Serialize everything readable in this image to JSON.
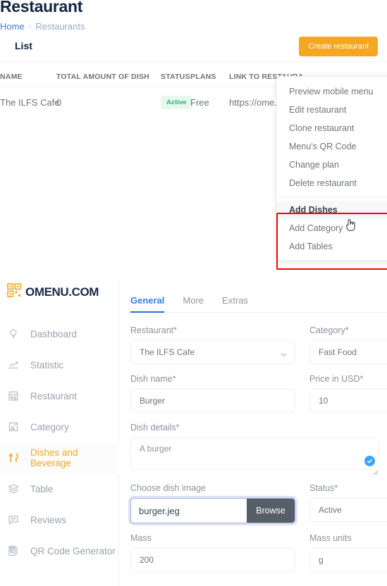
{
  "top": {
    "page_title": "Restaurant",
    "breadcrumb": {
      "home": "Home",
      "separator": "›",
      "current": "Restaurants"
    },
    "card": {
      "title": "List",
      "create_button": "Create restaurant"
    },
    "table": {
      "headers": [
        "NAME",
        "TOTAL AMOUNT OF DISH",
        "STATUS",
        "PLANS",
        "LINK TO RESTAURA"
      ],
      "rows": [
        {
          "name": "The ILFS Cafe",
          "total_amount_of_dish": "0",
          "status": "Active",
          "plans": "Free",
          "link": "https://ome.nu/"
        }
      ]
    },
    "dropdown": {
      "group_1": [
        "Preview mobile menu",
        "Edit restaurant",
        "Clone restaurant",
        "Menu's QR Code",
        "Change plan",
        "Delete restaurant"
      ],
      "group_2": [
        "Add Dishes",
        "Add Category",
        "Add Tables"
      ],
      "hovered_item": "Add Dishes",
      "highlight_color": "#ff0000"
    }
  },
  "bottom": {
    "brand": {
      "name": "OMENU.COM",
      "icon": "qr-code-icon"
    },
    "sidebar": {
      "items": [
        {
          "label": "Dashboard",
          "icon": "lightbulb-icon",
          "active": false
        },
        {
          "label": "Statistic",
          "icon": "trend-up-icon",
          "active": false
        },
        {
          "label": "Restaurant",
          "icon": "store-icon",
          "active": false
        },
        {
          "label": "Category",
          "icon": "signpost-icon",
          "active": false
        },
        {
          "label": "Dishes and Beverage",
          "icon": "cutlery-icon",
          "active": true
        },
        {
          "label": "Table",
          "icon": "layers-icon",
          "active": false
        },
        {
          "label": "Reviews",
          "icon": "comment-icon",
          "active": false
        },
        {
          "label": "QR Code Generator",
          "icon": "qr-generator-icon",
          "active": false
        }
      ],
      "active_color": "#f5a623"
    },
    "form": {
      "tabs": [
        {
          "label": "General",
          "active": true
        },
        {
          "label": "More",
          "active": false
        },
        {
          "label": "Extras",
          "active": false
        }
      ],
      "fields": {
        "restaurant": {
          "label": "Restaurant*",
          "value": "The ILFS Cafe"
        },
        "category": {
          "label": "Category*",
          "value": "Fast Food"
        },
        "dish_name": {
          "label": "Dish name*",
          "value": "Burger"
        },
        "price": {
          "label": "Price in USD*",
          "value": "10"
        },
        "dish_details": {
          "label": "Dish details*",
          "value": "A burger"
        },
        "dish_image": {
          "label": "Choose dish image",
          "value": "burger.jeg",
          "browse_label": "Browse"
        },
        "status": {
          "label": "Status*",
          "value": "Active"
        },
        "mass": {
          "label": "Mass",
          "value": "200"
        },
        "mass_units": {
          "label": "Mass units",
          "value": "g"
        }
      }
    }
  }
}
